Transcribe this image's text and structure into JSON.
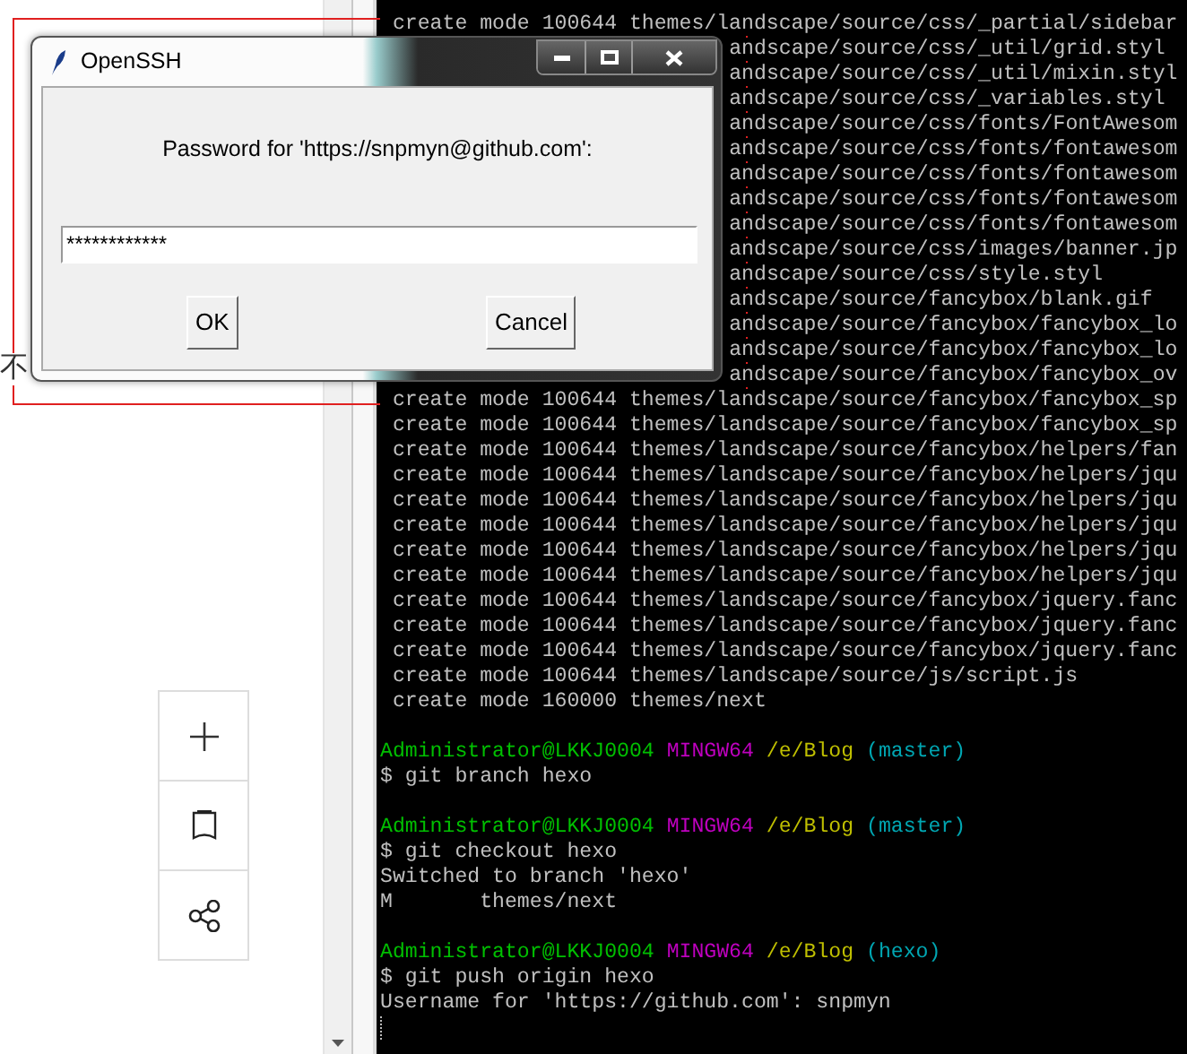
{
  "page": {
    "fragment": "不",
    "tools": [
      {
        "kind": "add"
      },
      {
        "kind": "bookmark"
      },
      {
        "kind": "share"
      }
    ]
  },
  "terminal": {
    "lines": [
      {
        "kind": "output",
        "text": " create mode 100644 themes/landscape/source/css/_partial/sidebar"
      },
      {
        "kind": "covered",
        "text": "andscape/source/css/_util/grid.styl"
      },
      {
        "kind": "covered",
        "text": "andscape/source/css/_util/mixin.styl"
      },
      {
        "kind": "covered",
        "text": "andscape/source/css/_variables.styl"
      },
      {
        "kind": "covered",
        "text": "andscape/source/css/fonts/FontAwesom"
      },
      {
        "kind": "covered",
        "text": "andscape/source/css/fonts/fontawesom"
      },
      {
        "kind": "covered",
        "text": "andscape/source/css/fonts/fontawesom"
      },
      {
        "kind": "covered",
        "text": "andscape/source/css/fonts/fontawesom"
      },
      {
        "kind": "covered",
        "text": "andscape/source/css/fonts/fontawesom"
      },
      {
        "kind": "covered",
        "text": "andscape/source/css/images/banner.jp"
      },
      {
        "kind": "covered",
        "text": "andscape/source/css/style.styl"
      },
      {
        "kind": "covered",
        "text": "andscape/source/fancybox/blank.gif"
      },
      {
        "kind": "covered",
        "text": "andscape/source/fancybox/fancybox_lo"
      },
      {
        "kind": "covered",
        "text": "andscape/source/fancybox/fancybox_lo"
      },
      {
        "kind": "covered",
        "text": "andscape/source/fancybox/fancybox_ov"
      },
      {
        "kind": "output",
        "text": " create mode 100644 themes/landscape/source/fancybox/fancybox_sp"
      },
      {
        "kind": "output",
        "text": " create mode 100644 themes/landscape/source/fancybox/fancybox_sp"
      },
      {
        "kind": "output",
        "text": " create mode 100644 themes/landscape/source/fancybox/helpers/fan"
      },
      {
        "kind": "output",
        "text": " create mode 100644 themes/landscape/source/fancybox/helpers/jqu"
      },
      {
        "kind": "output",
        "text": " create mode 100644 themes/landscape/source/fancybox/helpers/jqu"
      },
      {
        "kind": "output",
        "text": " create mode 100644 themes/landscape/source/fancybox/helpers/jqu"
      },
      {
        "kind": "output",
        "text": " create mode 100644 themes/landscape/source/fancybox/helpers/jqu"
      },
      {
        "kind": "output",
        "text": " create mode 100644 themes/landscape/source/fancybox/helpers/jqu"
      },
      {
        "kind": "output",
        "text": " create mode 100644 themes/landscape/source/fancybox/jquery.fanc"
      },
      {
        "kind": "output",
        "text": " create mode 100644 themes/landscape/source/fancybox/jquery.fanc"
      },
      {
        "kind": "output",
        "text": " create mode 100644 themes/landscape/source/fancybox/jquery.fanc"
      },
      {
        "kind": "output",
        "text": " create mode 100644 themes/landscape/source/js/script.js"
      },
      {
        "kind": "output",
        "text": " create mode 160000 themes/next"
      },
      {
        "kind": "blank"
      },
      {
        "kind": "prompt",
        "user": "Administrator@LKKJ0004",
        "system": "MINGW64",
        "path": "/e/Blog",
        "branch": "(master)"
      },
      {
        "kind": "output",
        "text": "$ git branch hexo"
      },
      {
        "kind": "blank"
      },
      {
        "kind": "prompt",
        "user": "Administrator@LKKJ0004",
        "system": "MINGW64",
        "path": "/e/Blog",
        "branch": "(master)"
      },
      {
        "kind": "output",
        "text": "$ git checkout hexo"
      },
      {
        "kind": "output",
        "text": "Switched to branch 'hexo'"
      },
      {
        "kind": "output",
        "text": "M       themes/next"
      },
      {
        "kind": "blank"
      },
      {
        "kind": "prompt",
        "user": "Administrator@LKKJ0004",
        "system": "MINGW64",
        "path": "/e/Blog",
        "branch": "(hexo)"
      },
      {
        "kind": "output",
        "text": "$ git push origin hexo"
      },
      {
        "kind": "output",
        "text": "Username for 'https://github.com': snpmyn"
      },
      {
        "kind": "cursor"
      }
    ]
  },
  "dialog": {
    "title": "OpenSSH",
    "label": "Password for 'https://snpmyn@github.com':",
    "value": "************",
    "buttons": [
      "OK",
      "Cancel"
    ]
  }
}
